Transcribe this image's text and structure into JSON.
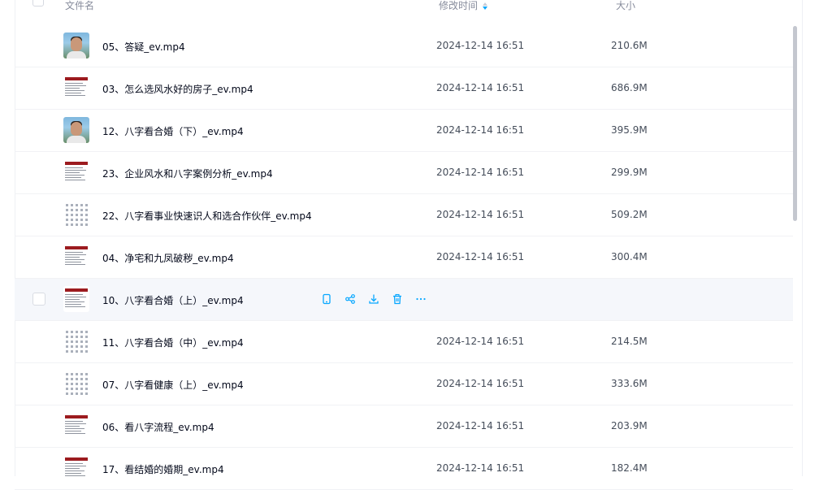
{
  "header": {
    "name_label": "文件名",
    "mtime_label": "修改时间",
    "size_label": "大小"
  },
  "accent_color": "#06a7ff",
  "files": [
    {
      "name": "05、答疑_ev.mp4",
      "mtime": "2024-12-14 16:51",
      "size": "210.6M",
      "thumb": "person"
    },
    {
      "name": "03、怎么选风水好的房子_ev.mp4",
      "mtime": "2024-12-14 16:51",
      "size": "686.9M",
      "thumb": "doc"
    },
    {
      "name": "12、八字看合婚（下）_ev.mp4",
      "mtime": "2024-12-14 16:51",
      "size": "395.9M",
      "thumb": "person"
    },
    {
      "name": "23、企业风水和八字案例分析_ev.mp4",
      "mtime": "2024-12-14 16:51",
      "size": "299.9M",
      "thumb": "doc"
    },
    {
      "name": "22、八字看事业快速识人和选合作伙伴_ev.mp4",
      "mtime": "2024-12-14 16:51",
      "size": "509.2M",
      "thumb": "grid"
    },
    {
      "name": "04、净宅和九凤破秽_ev.mp4",
      "mtime": "2024-12-14 16:51",
      "size": "300.4M",
      "thumb": "doc"
    },
    {
      "name": "10、八字看合婚（上）_ev.mp4",
      "mtime": "",
      "size": "",
      "thumb": "doc",
      "hover": true
    },
    {
      "name": "11、八字看合婚（中）_ev.mp4",
      "mtime": "2024-12-14 16:51",
      "size": "214.5M",
      "thumb": "grid"
    },
    {
      "name": "07、八字看健康（上）_ev.mp4",
      "mtime": "2024-12-14 16:51",
      "size": "333.6M",
      "thumb": "grid"
    },
    {
      "name": "06、看八字流程_ev.mp4",
      "mtime": "2024-12-14 16:51",
      "size": "203.9M",
      "thumb": "doc"
    },
    {
      "name": "17、看结婚的婚期_ev.mp4",
      "mtime": "2024-12-14 16:51",
      "size": "182.4M",
      "thumb": "doc"
    }
  ],
  "row_actions": [
    "phone-icon",
    "share-icon",
    "download-icon",
    "delete-icon",
    "more-icon"
  ]
}
